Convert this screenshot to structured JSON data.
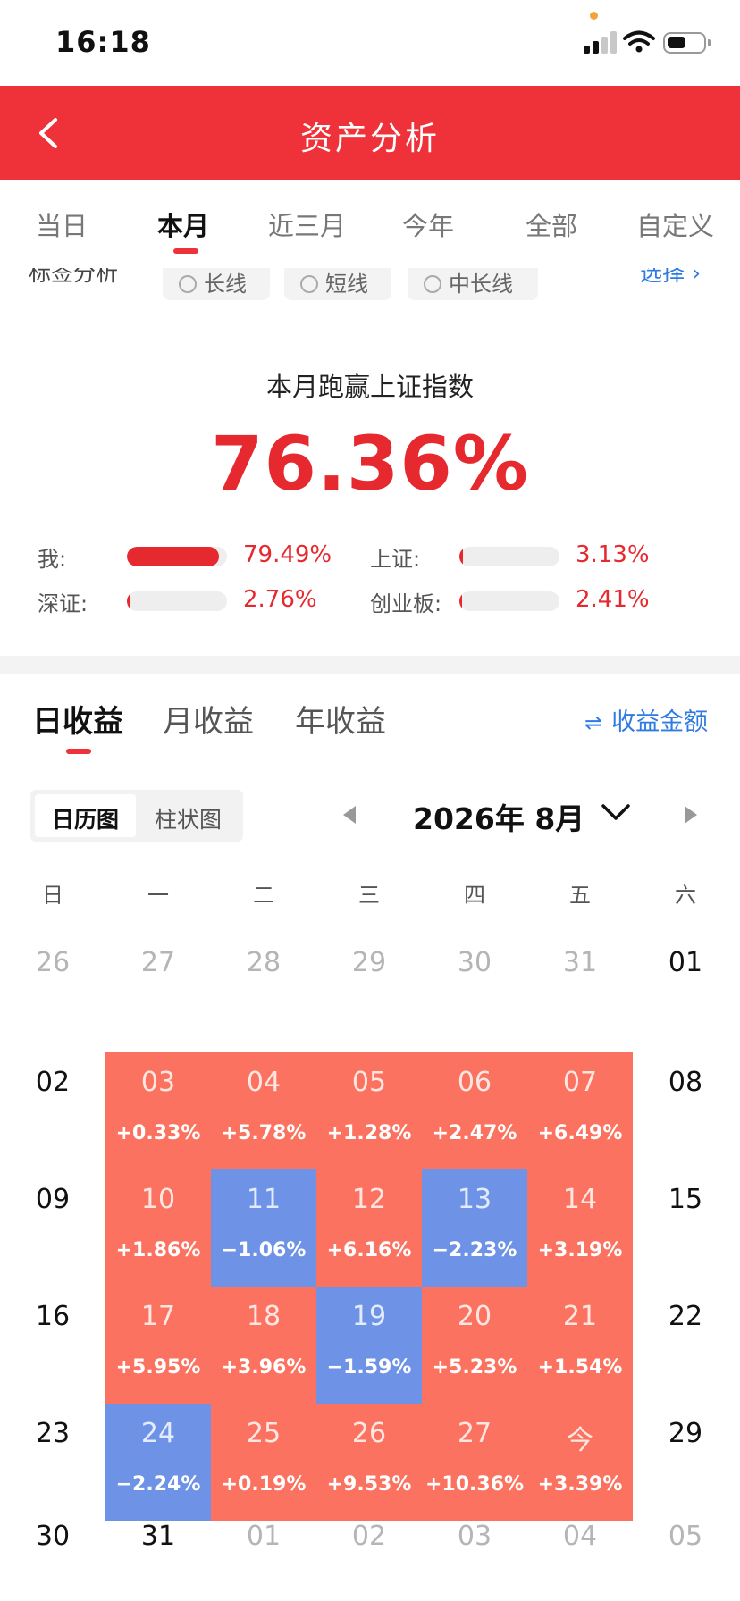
{
  "status_bar": {
    "time": "16:18"
  },
  "header": {
    "title": "资产分析"
  },
  "period_tabs": [
    {
      "label": "当日",
      "active": false
    },
    {
      "label": "本月",
      "active": true
    },
    {
      "label": "近三月",
      "active": false
    },
    {
      "label": "今年",
      "active": false
    },
    {
      "label": "全部",
      "active": false
    },
    {
      "label": "自定义",
      "active": false
    }
  ],
  "tag_filter": {
    "label": "标签分析",
    "options": [
      "长线",
      "短线",
      "中长线"
    ],
    "select_label": "选择 ›"
  },
  "summary": {
    "title": "本月跑赢上证指数",
    "value": "76.36%"
  },
  "comparisons": [
    {
      "label": "我:",
      "value": "79.49%",
      "fraction": 0.92
    },
    {
      "label": "上证:",
      "value": "3.13%",
      "fraction": 0.036
    },
    {
      "label": "深证:",
      "value": "2.76%",
      "fraction": 0.032
    },
    {
      "label": "创业板:",
      "value": "2.41%",
      "fraction": 0.028
    }
  ],
  "income_tabs": [
    {
      "label": "日收益",
      "active": true
    },
    {
      "label": "月收益",
      "active": false
    },
    {
      "label": "年收益",
      "active": false
    }
  ],
  "amount_toggle": {
    "icon": "swap-icon",
    "label": "收益金额"
  },
  "view_switch": {
    "calendar": "日历图",
    "bar": "柱状图"
  },
  "month_label": "2026年 8月",
  "weekdays": [
    "日",
    "一",
    "二",
    "三",
    "四",
    "五",
    "六"
  ],
  "calendar": [
    [
      {
        "day": "26",
        "state": "muted"
      },
      {
        "day": "27",
        "state": "muted"
      },
      {
        "day": "28",
        "state": "muted"
      },
      {
        "day": "29",
        "state": "muted"
      },
      {
        "day": "30",
        "state": "muted"
      },
      {
        "day": "31",
        "state": "muted"
      },
      {
        "day": "01",
        "state": "plain"
      }
    ],
    [
      {
        "day": "02",
        "state": "plain"
      },
      {
        "day": "03",
        "state": "gain",
        "pct": "+0.33%"
      },
      {
        "day": "04",
        "state": "gain",
        "pct": "+5.78%"
      },
      {
        "day": "05",
        "state": "gain",
        "pct": "+1.28%"
      },
      {
        "day": "06",
        "state": "gain",
        "pct": "+2.47%"
      },
      {
        "day": "07",
        "state": "gain",
        "pct": "+6.49%"
      },
      {
        "day": "08",
        "state": "plain"
      }
    ],
    [
      {
        "day": "09",
        "state": "plain"
      },
      {
        "day": "10",
        "state": "gain",
        "pct": "+1.86%"
      },
      {
        "day": "11",
        "state": "loss",
        "pct": "−1.06%"
      },
      {
        "day": "12",
        "state": "gain",
        "pct": "+6.16%"
      },
      {
        "day": "13",
        "state": "loss",
        "pct": "−2.23%"
      },
      {
        "day": "14",
        "state": "gain",
        "pct": "+3.19%"
      },
      {
        "day": "15",
        "state": "plain"
      }
    ],
    [
      {
        "day": "16",
        "state": "plain"
      },
      {
        "day": "17",
        "state": "gain",
        "pct": "+5.95%"
      },
      {
        "day": "18",
        "state": "gain",
        "pct": "+3.96%"
      },
      {
        "day": "19",
        "state": "loss",
        "pct": "−1.59%"
      },
      {
        "day": "20",
        "state": "gain",
        "pct": "+5.23%"
      },
      {
        "day": "21",
        "state": "gain",
        "pct": "+1.54%"
      },
      {
        "day": "22",
        "state": "plain"
      }
    ],
    [
      {
        "day": "23",
        "state": "plain"
      },
      {
        "day": "24",
        "state": "loss",
        "pct": "−2.24%"
      },
      {
        "day": "25",
        "state": "gain",
        "pct": "+0.19%"
      },
      {
        "day": "26",
        "state": "gain",
        "pct": "+9.53%"
      },
      {
        "day": "27",
        "state": "gain",
        "pct": "+10.36%"
      },
      {
        "day": "今",
        "state": "gain",
        "pct": "+3.39%"
      },
      {
        "day": "29",
        "state": "plain"
      }
    ],
    [
      {
        "day": "30",
        "state": "plain"
      },
      {
        "day": "31",
        "state": "plain"
      },
      {
        "day": "01",
        "state": "muted"
      },
      {
        "day": "02",
        "state": "muted"
      },
      {
        "day": "03",
        "state": "muted"
      },
      {
        "day": "04",
        "state": "muted"
      },
      {
        "day": "05",
        "state": "muted"
      }
    ]
  ],
  "colors": {
    "brand_red": "#ef323a",
    "gain": "#fb7360",
    "loss": "#6d92e6",
    "link": "#2f7be2"
  }
}
